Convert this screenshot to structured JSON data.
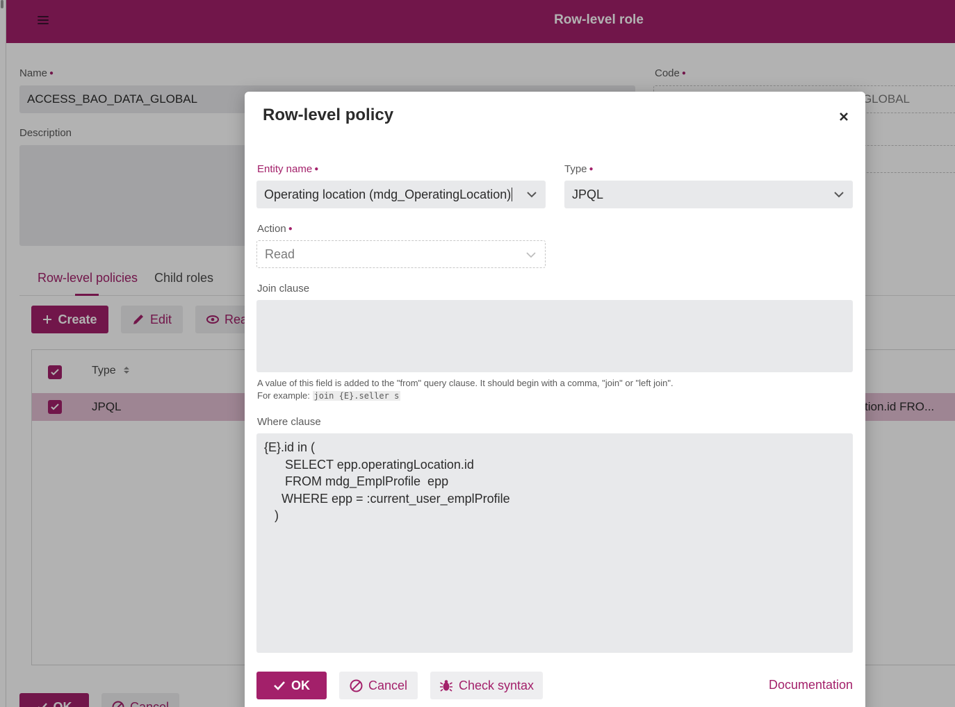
{
  "app": {
    "title": "Row-level role",
    "name_label": "Name",
    "name_value": "ACCESS_BAO_DATA_GLOBAL",
    "code_label": "Code",
    "code_value_visible": "GLOBAL",
    "description_label": "Description",
    "tabs": [
      {
        "label": "Row-level policies"
      },
      {
        "label": "Child roles"
      }
    ],
    "toolbar": {
      "create_label": "Create",
      "edit_label": "Edit",
      "read_label": "Rea"
    },
    "grid": {
      "header_type": "Type",
      "row_type": "JPQL",
      "row_trailing_text": "tion.id FRO..."
    },
    "bottom": {
      "ok_label": "OK",
      "cancel_label": "Cancel"
    }
  },
  "dialog": {
    "title": "Row-level policy",
    "entity_label": "Entity name",
    "entity_value": "Operating location (mdg_OperatingLocation)",
    "type_label": "Type",
    "type_value": "JPQL",
    "action_label": "Action",
    "action_value": "Read",
    "join_label": "Join clause",
    "join_value": "",
    "join_help_line1": "A value of this field is added to the \"from\" query clause. It should begin with a comma, \"join\" or \"left join\".",
    "join_help_example_prefix": "For example:",
    "join_help_example_code": "join {E}.seller s",
    "where_label": "Where clause",
    "where_value": "{E}.id in (\n      SELECT epp.operatingLocation.id\n      FROM mdg_EmplProfile  epp\n     WHERE epp = :current_user_emplProfile\n   )",
    "ok_label": "OK",
    "cancel_label": "Cancel",
    "check_syntax_label": "Check syntax",
    "documentation_label": "Documentation"
  },
  "colors": {
    "accent": "#a3206a",
    "field_bg": "#e8e9eb",
    "secondary_btn_bg": "#eeeef0"
  },
  "icons": [
    "hamburger-icon",
    "close-icon",
    "chevron-down-icon",
    "plus-icon",
    "pencil-icon",
    "eye-icon",
    "check-icon",
    "cancel-icon",
    "bug-icon",
    "sort-icon"
  ]
}
